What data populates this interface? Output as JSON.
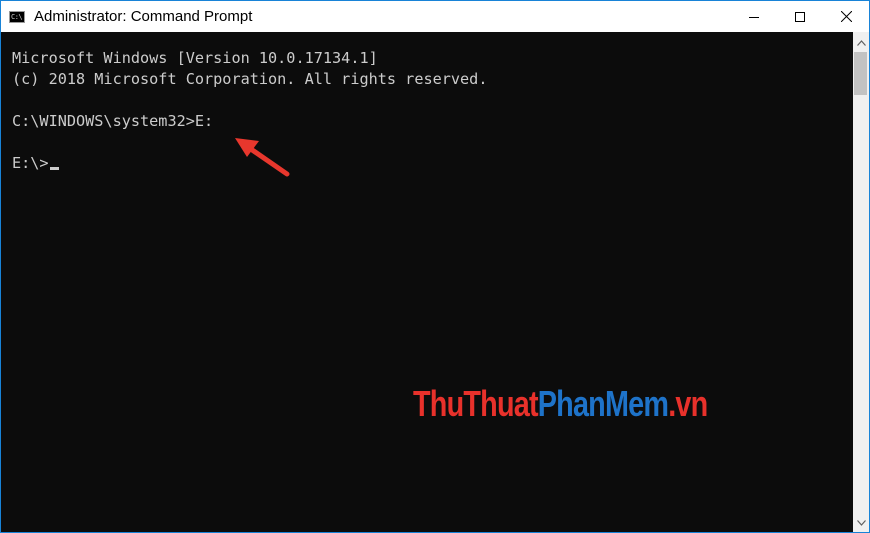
{
  "window": {
    "title": "Administrator: Command Prompt",
    "app_icon_text": "C:\\",
    "accent_color": "#1883d7"
  },
  "caption_buttons": {
    "minimize": "minimize-icon",
    "maximize": "maximize-icon",
    "close": "close-icon"
  },
  "console": {
    "background": "#0c0c0c",
    "text_color": "#cccccc",
    "lines": [
      "Microsoft Windows [Version 10.0.17134.1]",
      "(c) 2018 Microsoft Corporation. All rights reserved.",
      "",
      "C:\\WINDOWS\\system32>E:",
      "",
      "E:\\>"
    ]
  },
  "annotation": {
    "arrow_color": "#e8372d"
  },
  "watermark": {
    "part1": "ThuThuat",
    "part2": "PhanMem",
    "part3": ".vn"
  }
}
